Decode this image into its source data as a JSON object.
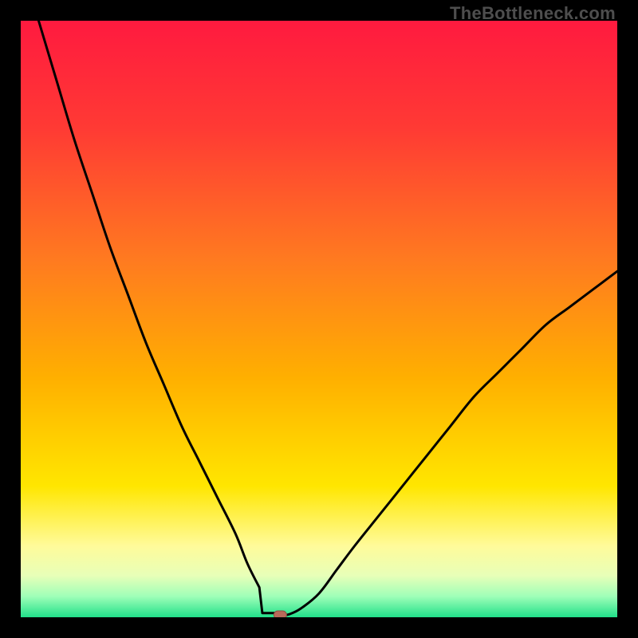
{
  "watermark": "TheBottleneck.com",
  "colors": {
    "curve": "#000000",
    "marker_fill": "#b86a5a",
    "marker_stroke": "#8f4e41",
    "gradient_stops": [
      {
        "offset": 0.0,
        "color": "#ff1a3f"
      },
      {
        "offset": 0.18,
        "color": "#ff3a34"
      },
      {
        "offset": 0.4,
        "color": "#ff7a20"
      },
      {
        "offset": 0.6,
        "color": "#ffb000"
      },
      {
        "offset": 0.78,
        "color": "#ffe600"
      },
      {
        "offset": 0.88,
        "color": "#fffb9a"
      },
      {
        "offset": 0.93,
        "color": "#e8ffb8"
      },
      {
        "offset": 0.965,
        "color": "#9fffb8"
      },
      {
        "offset": 1.0,
        "color": "#21e08a"
      }
    ]
  },
  "chart_data": {
    "type": "line",
    "title": "",
    "xlabel": "",
    "ylabel": "",
    "xlim": [
      0,
      100
    ],
    "ylim": [
      0,
      100
    ],
    "x": [
      0,
      3,
      6,
      9,
      12,
      15,
      18,
      21,
      24,
      27,
      30,
      33,
      36,
      38,
      40,
      41,
      42,
      43,
      44,
      45,
      47,
      50,
      53,
      56,
      60,
      64,
      68,
      72,
      76,
      80,
      84,
      88,
      92,
      96,
      100
    ],
    "values": [
      110,
      100,
      90,
      80,
      71,
      62,
      54,
      46,
      39,
      32,
      26,
      20,
      14,
      9,
      5,
      3,
      1.5,
      0.7,
      0.4,
      0.5,
      1.5,
      4,
      8,
      12,
      17,
      22,
      27,
      32,
      37,
      41,
      45,
      49,
      52,
      55,
      58
    ],
    "marker": {
      "x": 43.5,
      "y": 0.4
    },
    "flat_segment": {
      "x0": 40.5,
      "x1": 43.0,
      "y": 0.7
    }
  }
}
